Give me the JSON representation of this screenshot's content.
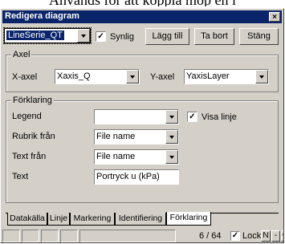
{
  "background_text": "Används för att koppla mop en l",
  "window": {
    "title": "Redigera diagram",
    "close_glyph": "×"
  },
  "toolbar": {
    "series_value": "LineSerie_QT",
    "visible_label": "Synlig",
    "visible_checked": true,
    "add_label": "Lägg till",
    "remove_label": "Ta bort",
    "close_label": "Stäng"
  },
  "axis_group": {
    "title": "Axel",
    "x_label": "X-axel",
    "x_value": "Xaxis_Q",
    "y_label": "Y-axel",
    "y_value": "YaxisLayer"
  },
  "legend_group": {
    "title": "Förklaring",
    "legend_label": "Legend",
    "legend_value": "",
    "show_line_label": "Visa linje",
    "show_line_checked": true,
    "title_from_label": "Rubrik från",
    "title_from_value": "File name",
    "text_from_label": "Text från",
    "text_from_value": "File name",
    "text_label": "Text",
    "text_value": "Portryck u (kPa)"
  },
  "tabs": [
    {
      "label": "Datakälla",
      "active": false
    },
    {
      "label": "Linje",
      "active": false
    },
    {
      "label": "Markering",
      "active": false
    },
    {
      "label": "Identifiering",
      "active": false
    },
    {
      "label": "Förklaring",
      "active": true
    }
  ],
  "status": {
    "page": "6 / 64",
    "lock_label": "Lock",
    "lock_checked": true,
    "n_label": "N",
    "minus_label": "-",
    "plus_label": "+"
  }
}
